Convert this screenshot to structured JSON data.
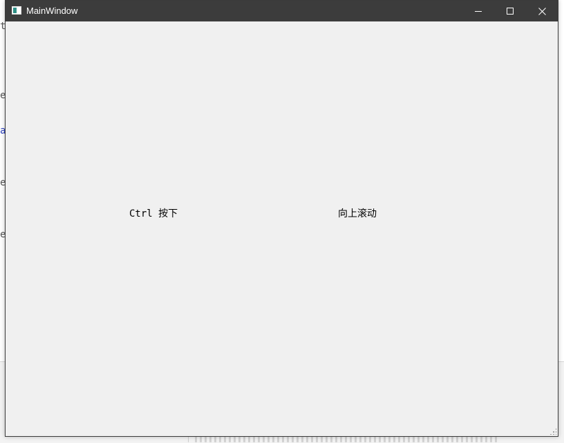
{
  "window": {
    "title": "MainWindow",
    "controls": {
      "minimize_icon": "minimize-icon",
      "maximize_icon": "maximize-icon",
      "close_icon": "close-icon"
    }
  },
  "content": {
    "left_label": "Ctrl 按下",
    "right_label": "向上滚动"
  },
  "colors": {
    "titlebar": "#3c3c3c",
    "client_background": "#f0f0f0",
    "title_text": "#ffffff"
  }
}
